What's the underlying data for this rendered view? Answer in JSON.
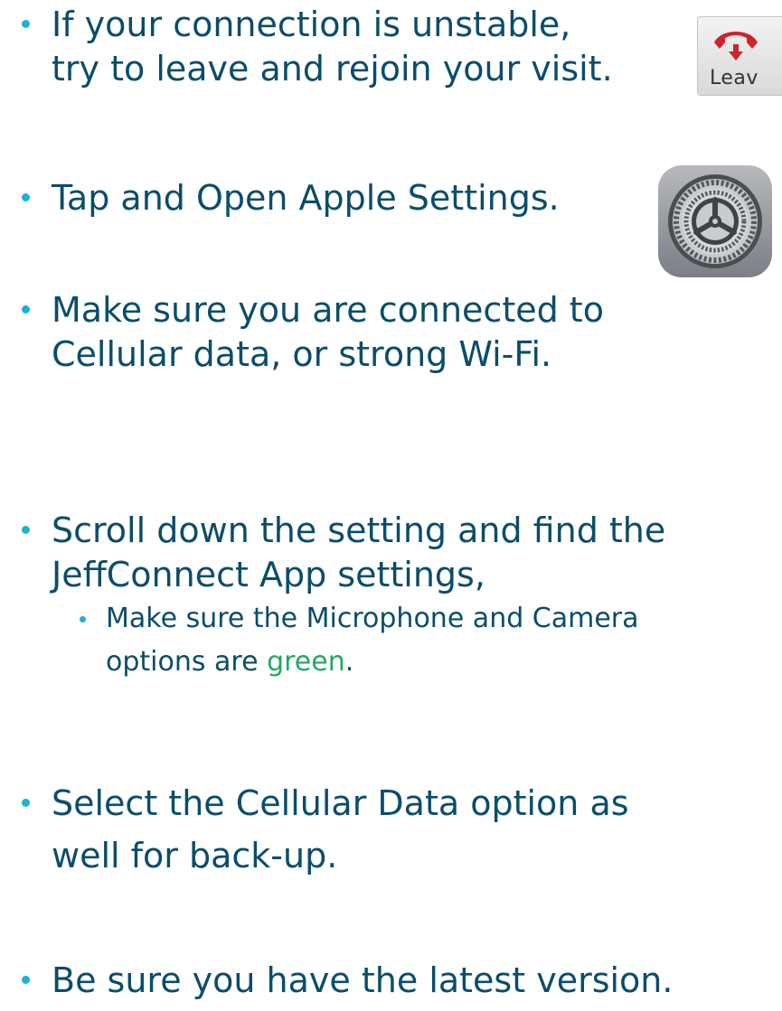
{
  "bullets": {
    "connection": {
      "line1": "If your connection is unstable,",
      "line2": "try to leave and rejoin your visit."
    },
    "settings": {
      "line1": "Tap and Open Apple Settings."
    },
    "network": {
      "line1": "Make sure you are connected to",
      "line2": "Cellular data, or strong Wi-Fi."
    },
    "scroll": {
      "line1": "Scroll down the setting and find the",
      "line2": "JeffConnect App settings,",
      "sub": {
        "line1": "Make sure the Microphone and Camera",
        "line2_prefix": "options are ",
        "line2_green": "green",
        "line2_suffix": "."
      }
    },
    "cellular": {
      "line1": "Select the Cellular Data option as",
      "line2": "well for back-up."
    },
    "version": {
      "line1": "Be sure you have the latest version."
    }
  },
  "leave_button": {
    "label": "Leav",
    "icon": "phone-hangup-icon"
  },
  "settings_app": {
    "icon": "settings-gear-icon"
  },
  "colors": {
    "text": "#0a4d6b",
    "bullet": "#1cb3cf",
    "highlight_green": "#21a95e",
    "hangup_red": "#d0222c"
  }
}
